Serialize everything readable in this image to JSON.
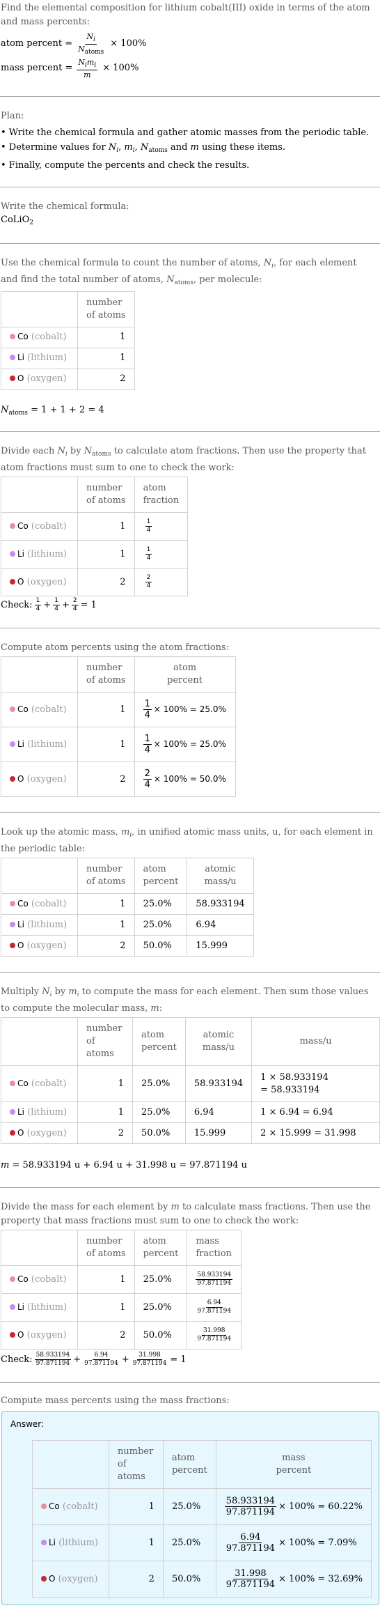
{
  "problem": {
    "intro": "Find the elemental composition for lithium cobalt(III) oxide in terms of the atom and mass percents:",
    "atom_percent_label": "atom percent =",
    "atom_percent_num": "N",
    "atom_percent_num_sub": "i",
    "atom_percent_den": "N",
    "atom_percent_den_sub": "atoms",
    "times_100": "× 100%",
    "mass_percent_label": "mass percent =",
    "mass_percent_num": "N",
    "mass_percent_num_sub": "i",
    "mass_percent_num2": "m",
    "mass_percent_num2_sub": "i",
    "mass_percent_den": "m"
  },
  "plan": {
    "title": "Plan:",
    "items": [
      "Write the chemical formula and gather atomic masses from the periodic table.",
      "Determine values for N_i, m_i, N_atoms and m using these items.",
      "Finally, compute the percents and check the results."
    ],
    "item2_prefix": "• Determine values for ",
    "item2_suffix": " using these items.",
    "item1": "• Write the chemical formula and gather atomic masses from the periodic table.",
    "item3": "• Finally, compute the percents and check the results."
  },
  "formula": {
    "intro": "Write the chemical formula:",
    "text": "CoLiO",
    "subscript": "2"
  },
  "elements": [
    {
      "symbol": "Co",
      "name": "(cobalt)",
      "color": "#e8909c",
      "count": "1",
      "atom_fraction_num": "1",
      "atom_fraction_den": "4",
      "atom_percent": "25.0%",
      "atomic_mass": "58.933194",
      "mass_expr_line1": "1 × 58.933194",
      "mass_expr_line2": "= 58.933194",
      "mass": "58.933194",
      "mass_percent": "60.22%"
    },
    {
      "symbol": "Li",
      "name": "(lithium)",
      "color": "#c98af0",
      "count": "1",
      "atom_fraction_num": "1",
      "atom_fraction_den": "4",
      "atom_percent": "25.0%",
      "atomic_mass": "6.94",
      "mass_expr_line1": "1 × 6.94 = 6.94",
      "mass_expr_line2": "",
      "mass": "6.94",
      "mass_percent": "7.09%"
    },
    {
      "symbol": "O",
      "name": "(oxygen)",
      "color": "#c8282e",
      "count": "2",
      "atom_fraction_num": "2",
      "atom_fraction_den": "4",
      "atom_percent": "50.0%",
      "atomic_mass": "15.999",
      "mass_expr_line1": "2 × 15.999 = 31.998",
      "mass_expr_line2": "",
      "mass": "31.998",
      "mass_percent": "32.69%"
    }
  ],
  "headers": {
    "number_of_atoms_1": "number",
    "number_of_atoms_2": "of atoms",
    "atom_fraction_1": "atom",
    "atom_fraction_2": "fraction",
    "atom_percent_1": "atom",
    "atom_percent_2": "percent",
    "atomic_mass_1": "atomic",
    "atomic_mass_2": "mass/u",
    "mass_u": "mass/u",
    "mass_fraction_1": "mass",
    "mass_fraction_2": "fraction",
    "mass_percent_1": "mass",
    "mass_percent_2": "percent"
  },
  "step_count": {
    "intro_a": "Use the chemical formula to count the number of atoms, ",
    "intro_b": ", for each element and find the total number of atoms, ",
    "intro_c": ", per molecule:",
    "result": "= 1 + 1 + 2 = 4"
  },
  "step_fraction": {
    "intro_a": "Divide each ",
    "intro_b": " by ",
    "intro_c": " to calculate atom fractions. Then use the property that atom fractions must sum to one to check the work:",
    "check_label": "Check:",
    "check_result": "= 1"
  },
  "step_atom_percent": {
    "intro": "Compute atom percents using the atom fractions:",
    "times": "× 100% ="
  },
  "step_lookup": {
    "intro_a": "Look up the atomic mass, ",
    "intro_b": ", in unified atomic mass units, u, for each element in the periodic table:"
  },
  "step_multiply": {
    "intro_a": "Multiply ",
    "intro_b": " by ",
    "intro_c": " to compute the mass for each element. Then sum those values to compute the molecular mass, ",
    "intro_d": ":",
    "result": "= 58.933194 u + 6.94 u + 31.998 u = 97.871194 u"
  },
  "step_mass_fraction": {
    "intro_a": "Divide the mass for each element by ",
    "intro_b": " to calculate mass fractions. Then use the property that mass fractions must sum to one to check the work:",
    "denominator": "97.871194",
    "check_label": "Check:",
    "check_result": "= 1"
  },
  "step_mass_percent": {
    "intro": "Compute mass percents using the mass fractions:",
    "answer_label": "Answer:",
    "denominator": "97.871194",
    "times": "× 100% ="
  },
  "symbols": {
    "N": "N",
    "m": "m",
    "i": "i",
    "atoms": "atoms",
    "plus": "+",
    "comma": ","
  }
}
